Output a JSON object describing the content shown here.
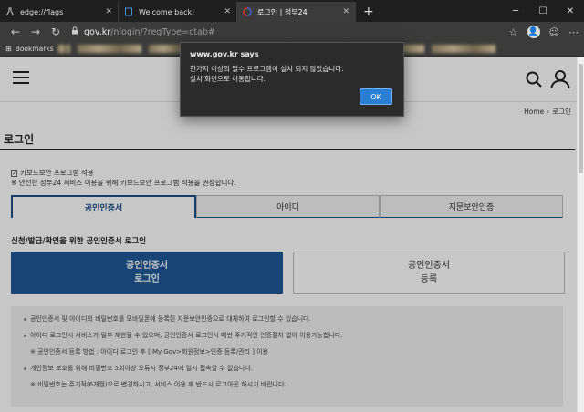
{
  "browser": {
    "tabs": [
      {
        "label": "edge://flags",
        "icon": "flask-icon",
        "active": false
      },
      {
        "label": "Welcome back!",
        "icon": "page-icon",
        "active": false
      },
      {
        "label": "로그인 | 정부24",
        "icon": "gov-icon",
        "active": true
      }
    ],
    "new_tab": "+",
    "url_host": "gov.kr",
    "url_path": "/nlogin/?regType=ctab#",
    "bookmarks_label": "Bookmarks",
    "controls": {
      "minimize": "─",
      "maximize": "☐",
      "close": "✕"
    }
  },
  "dialog": {
    "title": "www.gov.kr says",
    "line1": "한가지 이상의 필수 프로그램이 설치 되지 않았습니다.",
    "line2": "설치 화면으로 이동합니다.",
    "ok": "OK"
  },
  "breadcrumb": {
    "home": "Home",
    "sep": "›",
    "current": "로그인"
  },
  "page_title": "로그인",
  "options": {
    "keyboard_security": "키보드보안 프로그램 적용",
    "note": "※ 안전한 정부24 서비스 이용을 위해 키보드보안 프로그램 적용을 권장합니다."
  },
  "tabs": [
    "공인인증서",
    "아이디",
    "지문보안인증"
  ],
  "section_title": "신청/발급/확인을 위한 공인인증서 로그인",
  "buttons": {
    "login_line1": "공인인증서",
    "login_line2": "로그인",
    "register_line1": "공인인증서",
    "register_line2": "등록"
  },
  "notice": [
    "공인인증서 및 아이디의 비밀번호를 모바일폰에 등록된 지문보안인증으로 대체하여 로그인할 수 있습니다.",
    "아이디 로그인시 서비스가 일부 제한될 수 있으며, 공인인증서 로그인시 매번 주기적인 인증절차 없이 이용가능합니다.",
    "※ 공인인증서 등록 방법 : 아이디 로그인 후 [ My Gov>회원정보>인증 등록/관리 ] 이용",
    "개인정보 보호를 위해 비밀번호 5회이상 오류시 정부24에 일시 접속할 수 없습니다.",
    "※ 비밀번호는 주기적(6개월)으로 변경하시고, 서비스 이용 후 반드시 로그아웃 하시기 바랍니다."
  ]
}
